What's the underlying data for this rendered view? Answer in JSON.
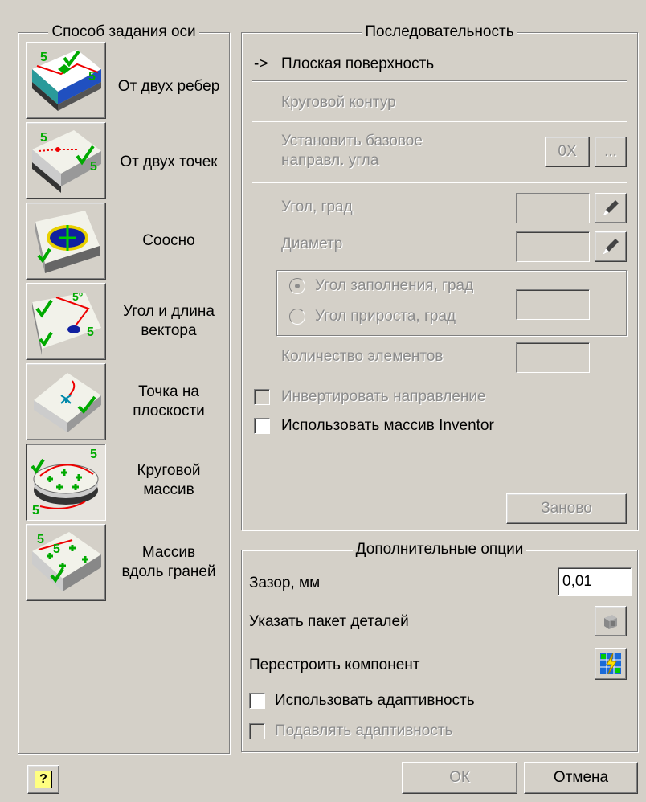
{
  "axis_method": {
    "title": "Способ задания оси",
    "items": [
      {
        "id": "two-edges",
        "label": "От двух ребер",
        "icon": "two-edges-icon",
        "selected": false
      },
      {
        "id": "two-points",
        "label": "От двух точек",
        "icon": "two-points-icon",
        "selected": false
      },
      {
        "id": "coaxial",
        "label": "Соосно",
        "icon": "coaxial-icon",
        "selected": false
      },
      {
        "id": "angle-vector",
        "label": "Угол и длина\nвектора",
        "icon": "angle-vector-icon",
        "selected": false
      },
      {
        "id": "point-on-plane",
        "label": "Точка на\nплоскости",
        "icon": "point-on-plane-icon",
        "selected": false
      },
      {
        "id": "circular-array",
        "label": "Круговой\nмассив",
        "icon": "circular-array-icon",
        "selected": true
      },
      {
        "id": "array-along-faces",
        "label": "Массив\nвдоль граней",
        "icon": "array-along-faces-icon",
        "selected": false
      }
    ]
  },
  "sequence": {
    "title": "Последовательность",
    "arrow": "->",
    "step_flat_surface": "Плоская поверхность",
    "step_circular_contour": "Круговой контур",
    "set_base_direction_line1": "Установить базовое",
    "set_base_direction_line2": "направл. угла",
    "ox_button": "0X",
    "ellipsis_button": "...",
    "angle_label": "Угол, град",
    "angle_value": "",
    "diameter_label": "Диаметр",
    "diameter_value": "",
    "radio_fill_angle": "Угол заполнения, град",
    "radio_increment_angle": "Угол прироста, град",
    "angle_mode_value": "",
    "count_label": "Количество элементов",
    "count_value": "",
    "invert_direction": "Инвертировать направление",
    "use_inventor_array": "Использовать массив Inventor",
    "reset_button": "Заново"
  },
  "extra_options": {
    "title": "Дополнительные опции",
    "gap_label": "Зазор, мм",
    "gap_value": "0,01",
    "parts_package_label": "Указать пакет деталей",
    "rebuild_label": "Перестроить компонент",
    "use_adaptivity": "Использовать адаптивность",
    "suppress_adaptivity": "Подавлять адаптивность"
  },
  "footer": {
    "help_icon": "?",
    "ok_button": "ОК",
    "cancel_button": "Отмена"
  },
  "colors": {
    "face": "#d4d0c8",
    "disabled_text": "#8c8c8c",
    "check_green": "#00a000",
    "red_marker": "#e00000"
  }
}
